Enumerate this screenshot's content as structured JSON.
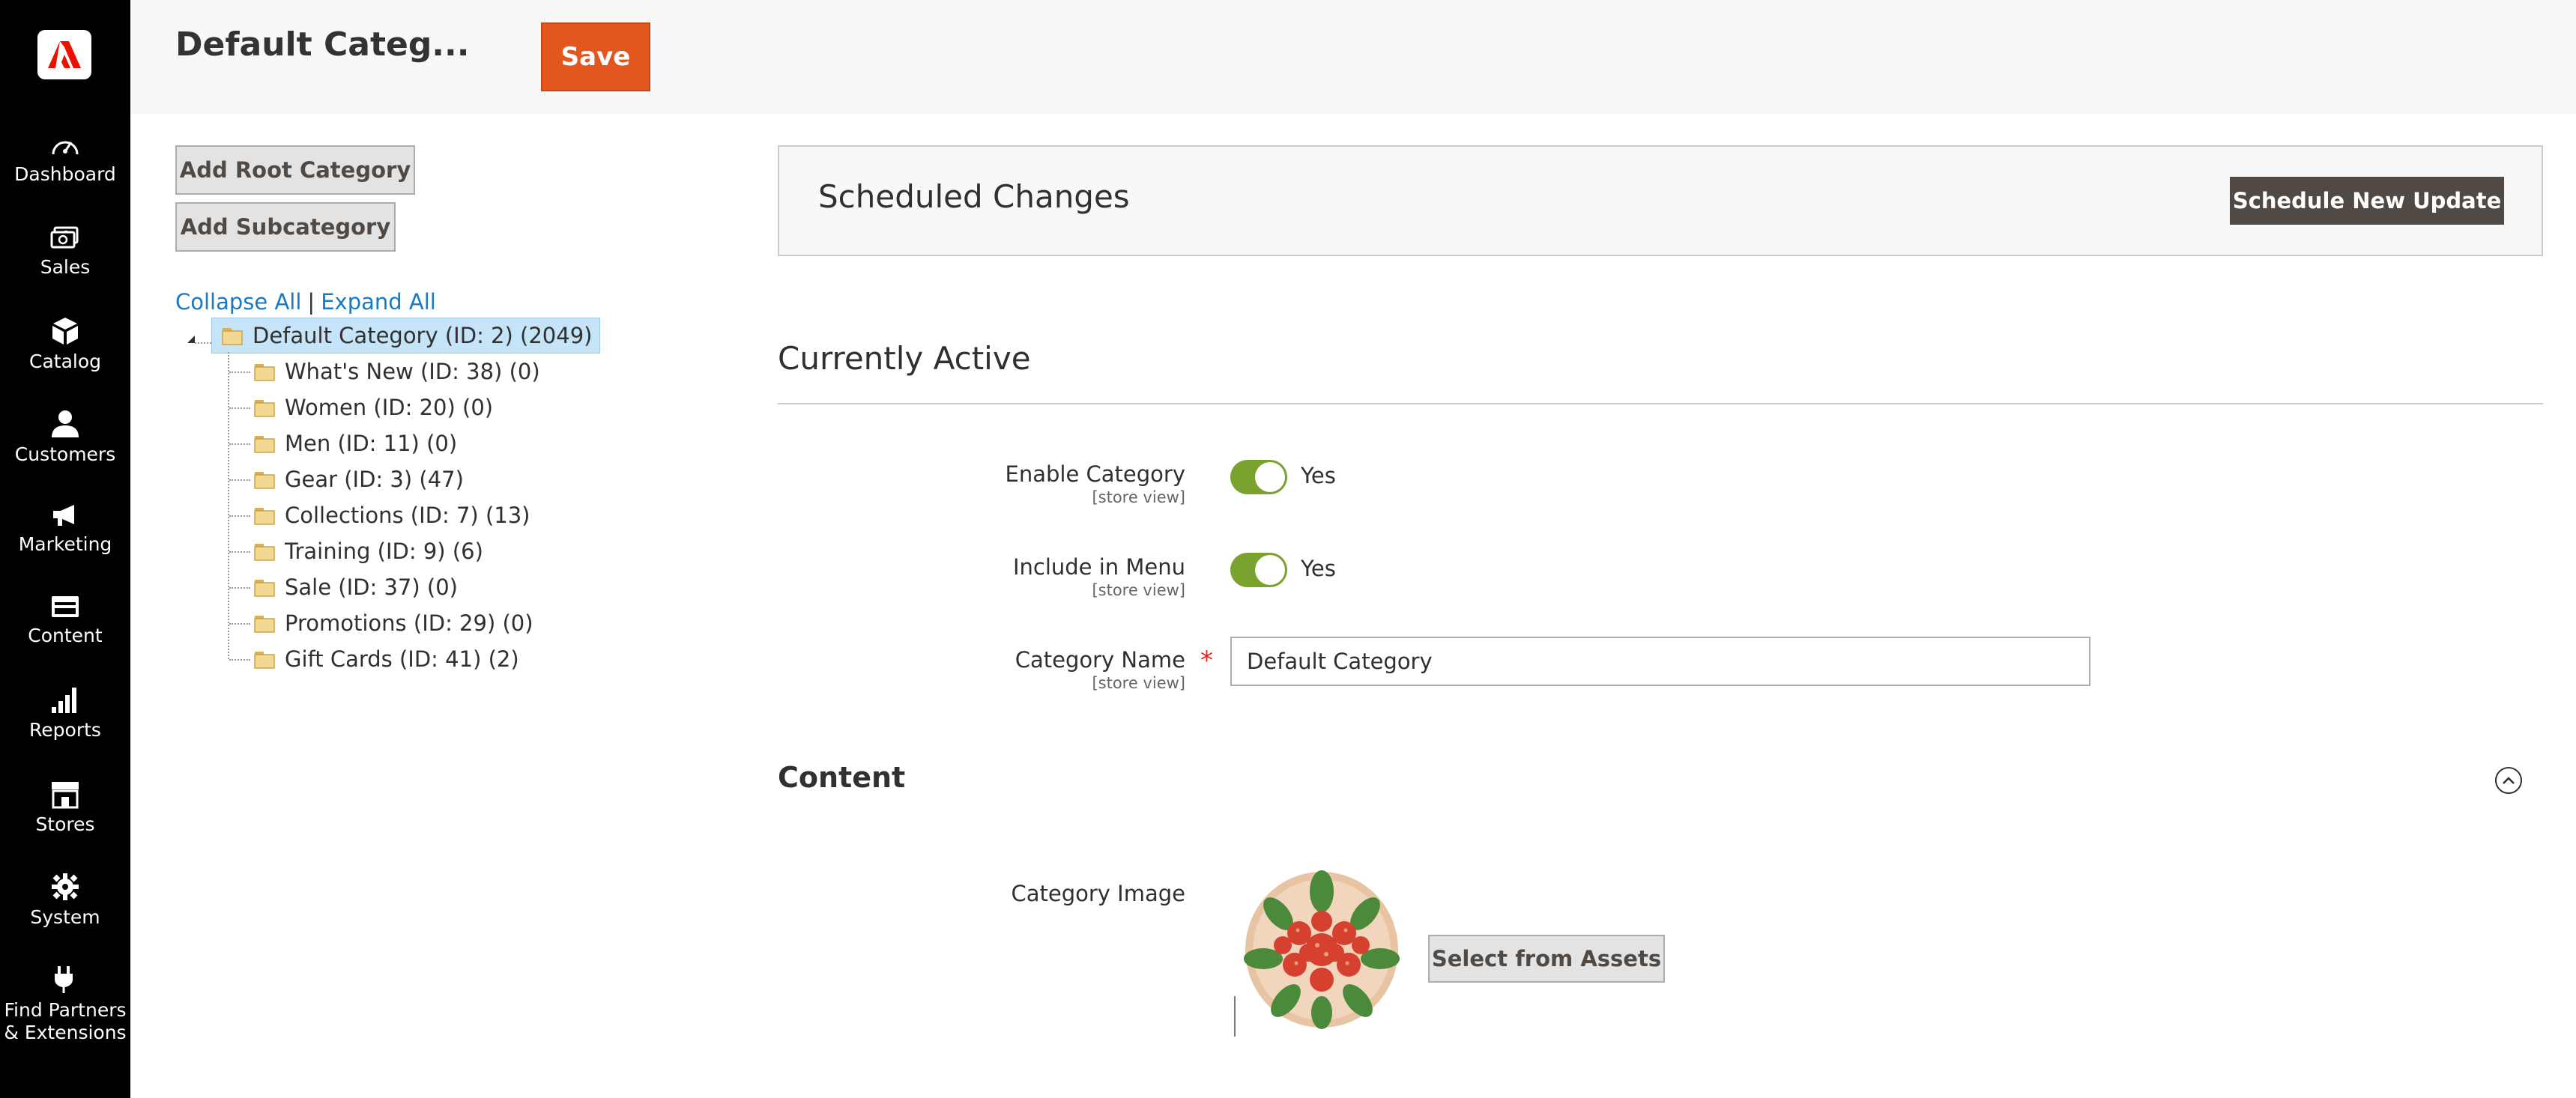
{
  "sidebar": {
    "logo_icon": "adobe-logo-icon",
    "items": [
      {
        "label": "Dashboard",
        "icon": "dashboard-icon"
      },
      {
        "label": "Sales",
        "icon": "dollar-icon"
      },
      {
        "label": "Catalog",
        "icon": "cube-icon"
      },
      {
        "label": "Customers",
        "icon": "person-icon"
      },
      {
        "label": "Marketing",
        "icon": "megaphone-icon"
      },
      {
        "label": "Content",
        "icon": "layout-icon"
      },
      {
        "label": "Reports",
        "icon": "bar-chart-icon"
      },
      {
        "label": "Stores",
        "icon": "storefront-icon"
      },
      {
        "label": "System",
        "icon": "gear-icon"
      },
      {
        "label_line1": "Find Partners",
        "label_line2": "& Extensions",
        "icon": "plug-icon"
      }
    ],
    "active": "Catalog"
  },
  "header": {
    "title": "Default Categ...",
    "save_label": "Save"
  },
  "left_panel": {
    "add_root_label": "Add Root Category",
    "add_sub_label": "Add Subcategory",
    "collapse_all": "Collapse All",
    "separator": "|",
    "expand_all": "Expand All",
    "tree": {
      "root": "Default Category (ID: 2) (2049)",
      "children": [
        "What's New (ID: 38) (0)",
        "Women (ID: 20) (0)",
        "Men (ID: 11) (0)",
        "Gear (ID: 3) (47)",
        "Collections (ID: 7) (13)",
        "Training (ID: 9) (6)",
        "Sale (ID: 37) (0)",
        "Promotions (ID: 29) (0)",
        "Gift Cards (ID: 41) (2)"
      ]
    }
  },
  "scheduled": {
    "title": "Scheduled Changes",
    "button_label": "Schedule New Update"
  },
  "active_section": {
    "title": "Currently Active",
    "enable_category": {
      "label": "Enable Category",
      "scope": "[store view]",
      "value": "Yes"
    },
    "include_in_menu": {
      "label": "Include in Menu",
      "scope": "[store view]",
      "value": "Yes"
    },
    "category_name": {
      "label": "Category Name",
      "scope": "[store view]",
      "required_mark": "*",
      "value": "Default Category"
    }
  },
  "content_section": {
    "title": "Content",
    "category_image_label": "Category Image",
    "select_assets_label": "Select from Assets"
  },
  "colors": {
    "brand_orange": "#e3571f",
    "toggle_green": "#79a22e",
    "link_blue": "#1979c3",
    "dark_button": "#514943"
  }
}
